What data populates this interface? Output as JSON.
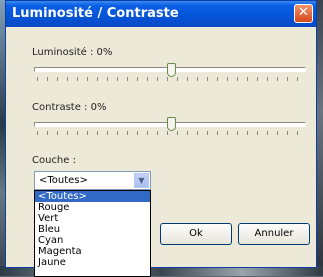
{
  "window": {
    "title": "Luminosité / Contraste",
    "close_symbol": "✕"
  },
  "brightness": {
    "label": "Luminosité : 0%",
    "level_percent": 0
  },
  "contrast": {
    "label": "Contraste : 0%",
    "level_percent": 0
  },
  "layer": {
    "label": "Couche :",
    "selected": "<Toutes>",
    "options": [
      "<Toutes>",
      "Rouge",
      "Vert",
      "Bleu",
      "Cyan",
      "Magenta",
      "Jaune"
    ]
  },
  "buttons": {
    "ok": "Ok",
    "cancel": "Annuler"
  }
}
